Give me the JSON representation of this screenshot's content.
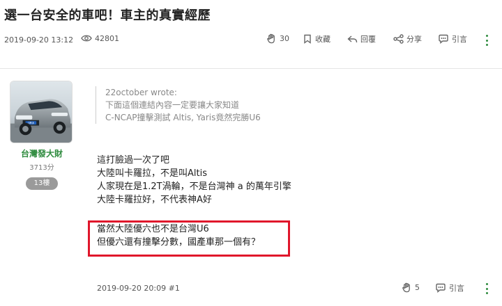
{
  "post": {
    "title": "選一台安全的車吧！車主的真實經歷",
    "date": "2019-09-20 13:12",
    "views": "42801"
  },
  "actions": {
    "like_count": "30",
    "save_label": "收藏",
    "reply_label": "回覆",
    "share_label": "分享",
    "quote_label": "引言"
  },
  "author": {
    "name": "台灣發大財",
    "score": "3713分",
    "floor_badge": "13樓",
    "avatar_plate": "URX"
  },
  "reply": {
    "quote": {
      "who": "22october wrote:",
      "lines": [
        "下面這個連結內容一定要讓大家知道",
        "C-NCAP撞擊測試 Altis, Yaris竟然完勝U6"
      ]
    },
    "lines": [
      "這打臉過一次了吧",
      "大陸叫卡羅拉，不是叫Altis",
      "人家現在是1.2T渦輪，不是台灣神 a 的萬年引擎",
      "大陸卡羅拉好，不代表神A好"
    ],
    "highlight_lines": [
      "當然大陸優六也不是台灣U6",
      "但優六還有撞擊分數，國產車那一個有？"
    ],
    "footer_date": "2019-09-20 20:09 #1",
    "like_count": "5",
    "quote_label": "引言"
  },
  "colors": {
    "accent": "#2e8b3e",
    "highlight_border": "#e0162b"
  },
  "icons": [
    "eye-icon",
    "clap-icon",
    "bookmark-icon",
    "reply-icon",
    "share-icon",
    "quote-icon",
    "kebab-menu-icon"
  ]
}
